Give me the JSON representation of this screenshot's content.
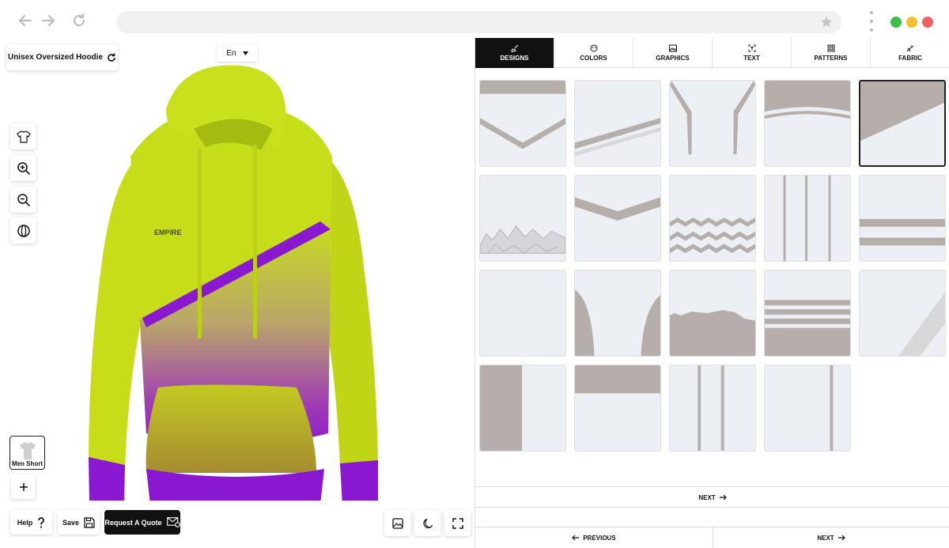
{
  "browser": {
    "back_icon": "arrow-left-icon",
    "forward_icon": "arrow-right-icon",
    "reload_icon": "reload-icon",
    "url": "",
    "window_controls": [
      "#3dbf4b",
      "#f5bf2f",
      "#f0625f"
    ]
  },
  "viewer": {
    "product_label": "Unisex Oversized Hoodie",
    "language": "En",
    "logo_text": "EMPIRE",
    "variant_label": "Men Short",
    "help_label": "Help",
    "save_label": "Save",
    "quote_label": "Request A Quote",
    "colors": {
      "body": "#c7e01a",
      "accent": "#8a1ad0"
    }
  },
  "tabs": [
    {
      "label": "DESIGNS",
      "icon": "brush-icon",
      "active": true
    },
    {
      "label": "COLORS",
      "icon": "palette-icon",
      "active": false
    },
    {
      "label": "GRAPHICS",
      "icon": "image-icon",
      "active": false
    },
    {
      "label": "TEXT",
      "icon": "text-icon",
      "active": false
    },
    {
      "label": "PATTERNS",
      "icon": "grid-icon",
      "active": false
    },
    {
      "label": "FABRIC",
      "icon": "needle-icon",
      "active": false
    }
  ],
  "designs": {
    "selected_index": 4,
    "count": 19
  },
  "pagination": {
    "next_label": "NEXT",
    "previous_label": "PREVIOUS",
    "next_bottom_label": "NEXT"
  }
}
